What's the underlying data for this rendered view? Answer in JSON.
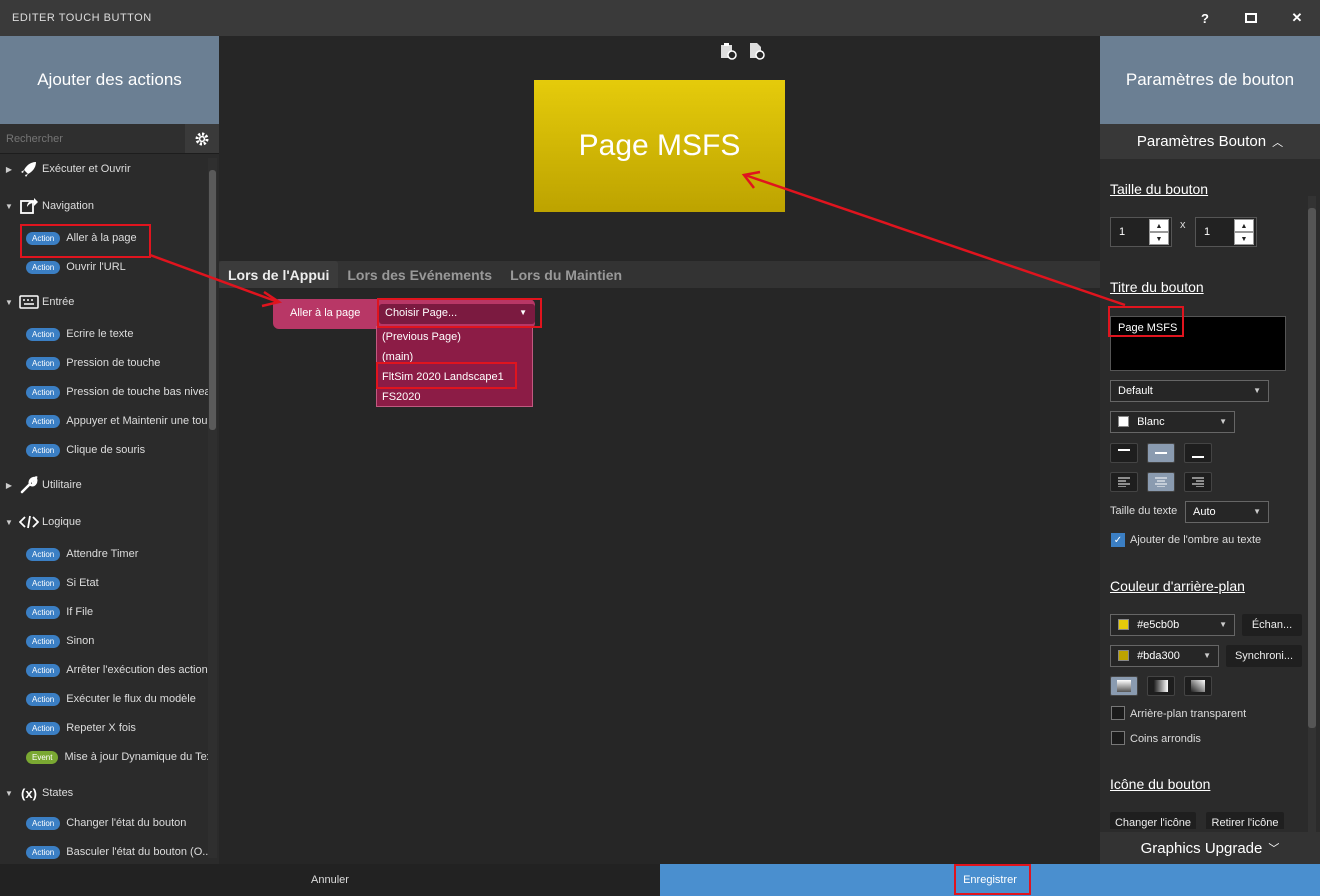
{
  "window": {
    "title": "EDITER TOUCH BUTTON",
    "help_label": "?",
    "close_label": "✕"
  },
  "left_panel": {
    "header": "Ajouter des actions",
    "search_placeholder": "Rechercher",
    "categories": [
      {
        "label": "Exécuter et Ouvrir"
      },
      {
        "label": "Navigation"
      },
      {
        "label": "Entrée"
      },
      {
        "label": "Utilitaire"
      },
      {
        "label": "Logique"
      },
      {
        "label": "States"
      }
    ],
    "actions": [
      {
        "badge": "Action",
        "label": "Aller à la page"
      },
      {
        "badge": "Action",
        "label": "Ouvrir l'URL"
      },
      {
        "badge": "Action",
        "label": "Ecrire le texte"
      },
      {
        "badge": "Action",
        "label": "Pression de touche"
      },
      {
        "badge": "Action",
        "label": "Pression de touche bas niveau"
      },
      {
        "badge": "Action",
        "label": "Appuyer et Maintenir une touche"
      },
      {
        "badge": "Action",
        "label": "Clique de souris"
      },
      {
        "badge": "Action",
        "label": "Attendre Timer"
      },
      {
        "badge": "Action",
        "label": "Si Etat"
      },
      {
        "badge": "Action",
        "label": "If File"
      },
      {
        "badge": "Action",
        "label": "Sinon"
      },
      {
        "badge": "Action",
        "label": "Arrêter l'exécution des actions"
      },
      {
        "badge": "Action",
        "label": "Exécuter le flux du modèle"
      },
      {
        "badge": "Action",
        "label": "Repeter X fois"
      },
      {
        "badge": "Event",
        "label": "Mise à jour Dynamique du Texte"
      },
      {
        "badge": "Action",
        "label": "Changer l'état du bouton"
      },
      {
        "badge": "Action",
        "label": "Basculer l'état du bouton (O..."
      }
    ]
  },
  "center": {
    "preview_text": "Page MSFS",
    "preview_colors": {
      "top": "#e5cb0b",
      "bottom": "#bda300"
    },
    "tabs": [
      {
        "label": "Lors de l'Appui"
      },
      {
        "label": "Lors des Evénements"
      },
      {
        "label": "Lors du Maintien"
      }
    ],
    "action_label": "Aller à la page",
    "select_value": "Choisir Page...",
    "dropdown_options": [
      "(Previous Page)",
      "(main)",
      "FltSim 2020 Landscape1",
      "FS2020"
    ]
  },
  "right_panel": {
    "header": "Paramètres de bouton",
    "subheader": "Paramètres Bouton",
    "size_title": "Taille du bouton",
    "size_w": "1",
    "size_h": "1",
    "size_x": "x",
    "title_section": "Titre du bouton",
    "title_value": "Page MSFS",
    "font_select": "Default",
    "color_select": "Blanc",
    "text_size_label": "Taille du texte",
    "text_size_value": "Auto",
    "shadow_label": "Ajouter de l'ombre au texte",
    "bg_section": "Couleur d'arrière-plan",
    "bg_color1": "#e5cb0b",
    "bg_color2": "#bda300",
    "swap_label": "Échan...",
    "sync_label": "Synchroni...",
    "transparent_label": "Arrière-plan transparent",
    "rounded_label": "Coins arrondis",
    "icon_section": "Icône du bouton",
    "change_icon_label": "Changer l'icône",
    "remove_icon_label": "Retirer l'icône",
    "graphics_label": "Graphics Upgrade"
  },
  "footer": {
    "cancel_label": "Annuler",
    "save_label": "Enregistrer"
  },
  "colors": {
    "accent": "#4a8fcf",
    "header": "#6b7f93",
    "action_pill": "#b83766",
    "annotation": "#e0141e"
  }
}
